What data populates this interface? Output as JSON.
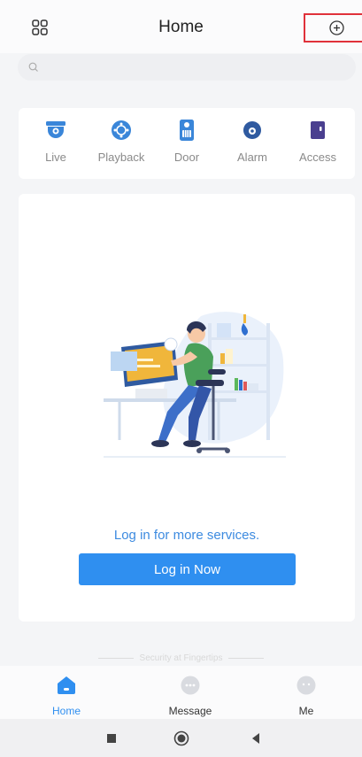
{
  "header": {
    "title": "Home"
  },
  "search": {
    "placeholder": ""
  },
  "quick_access": [
    {
      "label": "Live",
      "icon": "camera-icon"
    },
    {
      "label": "Playback",
      "icon": "playback-icon"
    },
    {
      "label": "Door",
      "icon": "door-icon"
    },
    {
      "label": "Alarm",
      "icon": "alarm-icon"
    },
    {
      "label": "Access",
      "icon": "access-icon"
    }
  ],
  "main": {
    "promo_text": "Log in for more services.",
    "login_button": "Log in Now"
  },
  "slogan": "Security at Fingertips",
  "tabs": [
    {
      "label": "Home",
      "icon": "home-icon",
      "active": true
    },
    {
      "label": "Message",
      "icon": "message-icon",
      "active": false
    },
    {
      "label": "Me",
      "icon": "profile-icon",
      "active": false
    }
  ],
  "colors": {
    "accent": "#2f8ff0",
    "highlight_box": "#e0313a"
  }
}
